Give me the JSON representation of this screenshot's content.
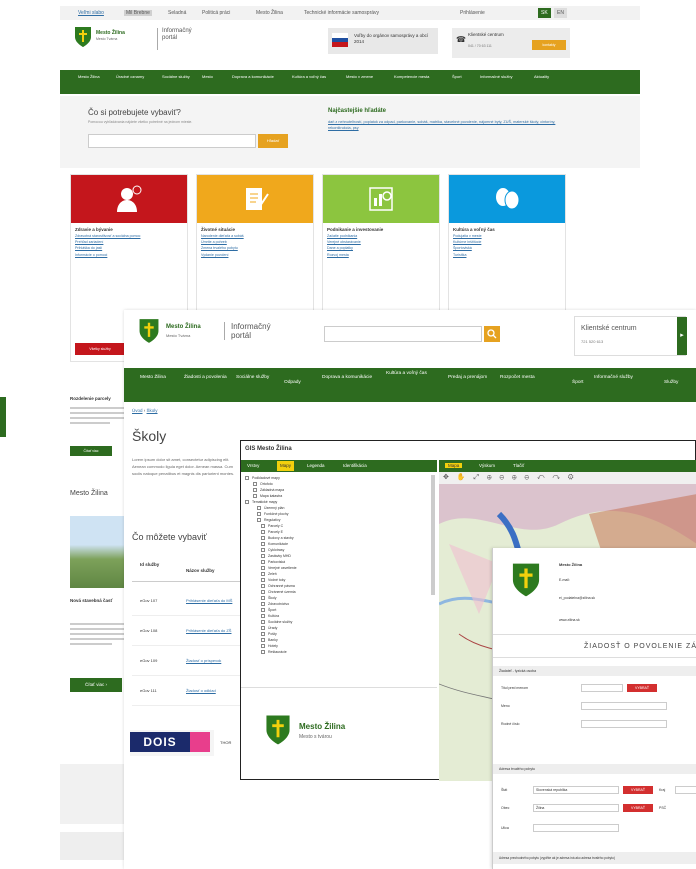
{
  "colors": {
    "brand_green": "#2d6b1f",
    "accent_orange": "#e6a220",
    "red_card": "#c4161c",
    "orange_card": "#f0a81c",
    "green_card": "#8cc53f",
    "blue_card": "#0a99dd"
  },
  "topbar": {
    "items": [
      "Veľmi slabo",
      "Mil Brebne",
      "Seladná",
      "Politicá práci",
      "Mesto Žilina",
      "Technické informácie samosprávy"
    ],
    "language": "Prihlásenie",
    "lang_sk": "SK",
    "lang_en": "EN"
  },
  "header": {
    "city_name": "Mesto Žilina",
    "city_sub": "Mesto Tvárna",
    "portal_title": "Informačný portál",
    "elections": "Voľby do orgánov samosprávy a obcí 2014",
    "client_center": "Klientské centrum",
    "client_phone": "041 / 70 63 111",
    "client_button": "kontakty"
  },
  "nav": [
    "Mesto Žilina",
    "Úradné oznamy",
    "Sociálne služby",
    "Mesto",
    "Doprava a komunikácie",
    "Kultúra a voľný čas",
    "Mesto v zmene",
    "Kompetencie mesta",
    "Šport",
    "Informačné služby",
    "Aktuality"
  ],
  "search": {
    "heading": "Čo si potrebujete vybaviť?",
    "hint": "Pomocou vyhľadávania nájdete všetko potrebné na jednom mieste.",
    "button": "Hľadať",
    "popular_heading": "Najčastejšie hľadáte",
    "popular_text": "daň z nehnuteľností, poplatok za odpad, parkovanie, sobáš, matrika, stavebné povolenie, nájomné byty, ZUŠ, materské školy, cintoríny, rekonštrukcia, psy"
  },
  "cards": [
    {
      "title": "Zdravie a bývanie",
      "lines": [
        "Zdravotná starostlivosť a sociálna pomoc",
        "Prehľad zariadení",
        "Prihláška do jaslí",
        "Informácie o pomoci"
      ],
      "color": "#c4161c",
      "cta": "Všetky služby"
    },
    {
      "title": "Životné situácie",
      "lines": [
        "Narodenie dieťaťa a sobáš",
        "Úmrtie a pohreb",
        "Zmena trvalého pobytu",
        "Vydanie povolení"
      ],
      "color": "#f0a81c",
      "cta": ""
    },
    {
      "title": "Podnikanie a investovanie",
      "lines": [
        "Začatie podnikania",
        "Verejné obstarávanie",
        "Dane a poplatky",
        "Rozvoj mesta"
      ],
      "color": "#8cc53f",
      "cta": ""
    },
    {
      "title": "Kultúra a voľný čas",
      "lines": [
        "Podujatia v meste",
        "Kultúrne inštitúcie",
        "Športoviská",
        "Turistika"
      ],
      "color": "#0a99dd",
      "cta": ""
    }
  ],
  "left_snips": {
    "news_heading": "Rozdelenie parcely",
    "news_button": "Čítať viac",
    "mesto_heading": "Mesto Žilina",
    "mesto_caption": "Nová stavebná časť",
    "read_more": "Čítať viac"
  },
  "layerB": {
    "city_name": "Mesto Žilina",
    "city_sub": "Mesto Tvárna",
    "portal_title": "Informačný portál",
    "client_center": "Klientské centrum",
    "client_phone": "721 520 613",
    "nav": [
      "Mesto Žilina",
      "Žiadosti a povolenia",
      "Sociálne služby",
      "Odpady",
      "Doprava a komunikácie",
      "Kultúra a voľný čas",
      "Predaj a prenájom",
      "Rozpočet mesta",
      "Šport",
      "Informačné služby",
      "Služby"
    ],
    "breadcrumb_home": "Úvod",
    "breadcrumb_current": "Školy",
    "page_title": "Školy",
    "intro": "Lorem ipsum dolor sit amet, consectetur adipiscing elit. Aenean commodo ligula eget dolor. Aenean massa. Cum sociis natoque penatibus et magnis dis parturient montes.",
    "subheading": "Čo môžete vybaviť",
    "table_head": [
      "Id služby",
      "Názov služby"
    ],
    "table_rows": [
      [
        "eGov 107",
        "Prihlásenie dieťaťa do MŠ"
      ],
      [
        "eGov 108",
        "Prihlásenie dieťaťa do ZŠ"
      ],
      [
        "eGov 109",
        "Žiadosť o príspevok"
      ],
      [
        "eGov 111",
        "Žiadosť o odklad"
      ]
    ],
    "partner_logo": "DOIS",
    "partner_text": "THOR"
  },
  "layerC": {
    "title": "GIS Mesto Žilina",
    "tabs": [
      "Vrstvy",
      "Mapy",
      "Legenda",
      "Identifikácia"
    ],
    "map_tabs": [
      "Mapa",
      "Výskum",
      "Tlačiť"
    ],
    "tree": [
      "Podkladové mapy",
      "Ortofoto",
      "Základná mapa",
      "Mapa katastra",
      "Tematické mapy",
      "Územný plán",
      "Funkčné plochy",
      "Regulatívy",
      "Parcely C",
      "Parcely E",
      "Budovy a stavby",
      "Komunikácie",
      "Cyklotrasy",
      "Zastávky MHD",
      "Parkoviská",
      "Verejné osvetlenie",
      "Zeleň",
      "Vodné toky",
      "Ochranné pásma",
      "Chránené územia",
      "Školy",
      "Zdravotníctvo",
      "Šport",
      "Kultúra",
      "Sociálne služby",
      "Úrady",
      "Pošty",
      "Banky",
      "Hotely",
      "Reštaurácie"
    ],
    "logo_name": "Mesto Žilina",
    "logo_sub": "Mesto s tvárou"
  },
  "layerD": {
    "city": "Mesto Žilina",
    "line1": "Námestie obetí komunizmu 1",
    "line2": "011 31 Žilina",
    "email_label": "E-mail:",
    "email": "ei_podatelna@zilina.sk",
    "web": "www.zilina.sk",
    "form_title": "ŽIADOSŤ O POVOLENIE ZÁ",
    "section1": "Žiadateľ - fyzická osoba",
    "labels": [
      "Titul pred menom",
      "Meno",
      "Rodné číslo"
    ],
    "btn": "VYBRAŤ",
    "section2": "Adresa trvalého pobytu",
    "addr_labels": [
      "Štát",
      "Obec",
      "Ulica"
    ],
    "addr_values": [
      "Slovenská republika",
      "Žilina",
      ""
    ],
    "kraj": "Kraj",
    "psc": "PSČ",
    "section3": "Adresa prechodného pobytu (vyplňte ak je adresa iná ako adresa trvalého pobytu)"
  }
}
